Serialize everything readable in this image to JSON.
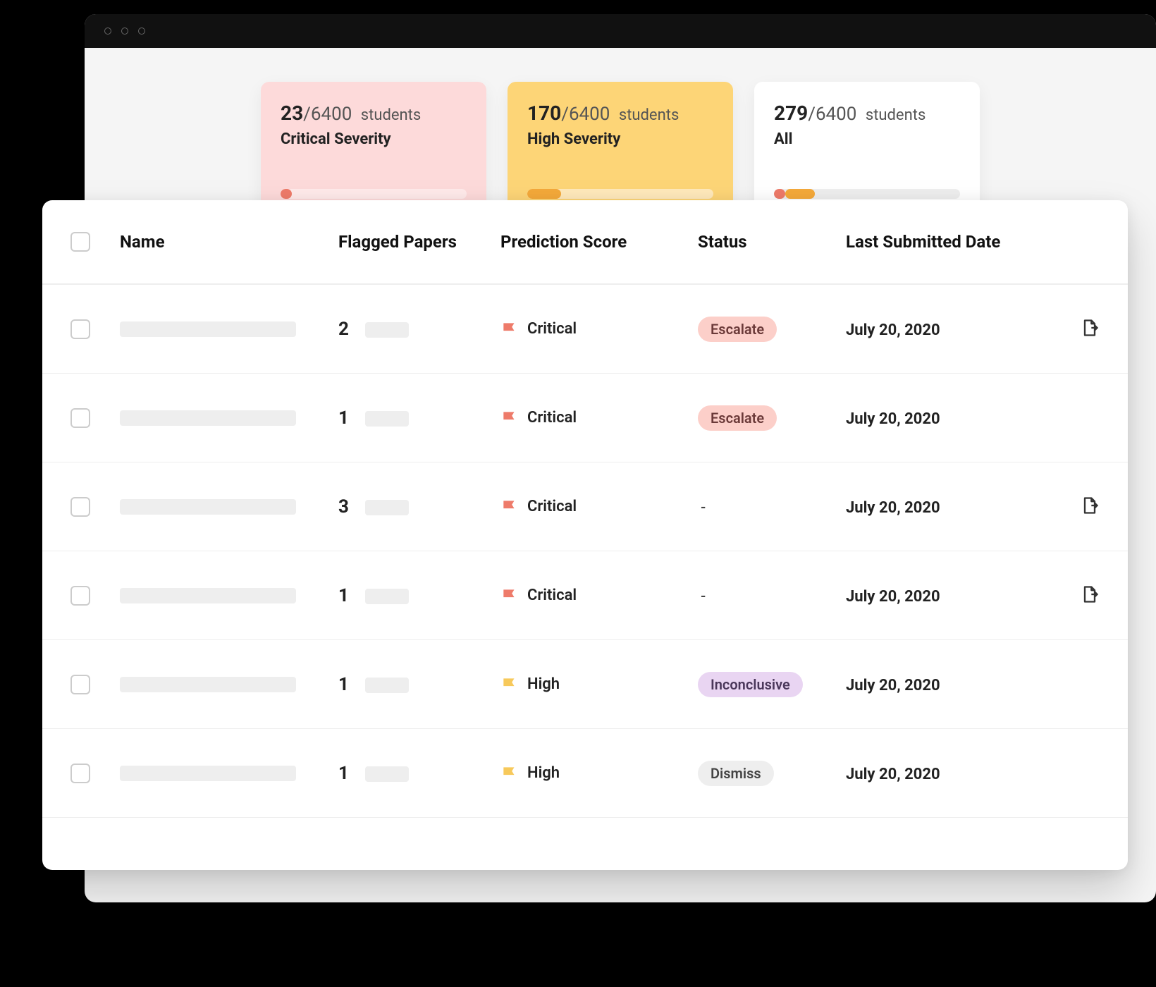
{
  "summary": {
    "cards": [
      {
        "count": "23",
        "total": "6400",
        "unit": "students",
        "label": "Critical Severity",
        "variant": "critical",
        "segments": [
          {
            "color": "#ee7b6a",
            "start": 0,
            "end": 6
          }
        ]
      },
      {
        "count": "170",
        "total": "6400",
        "unit": "students",
        "label": "High Severity",
        "variant": "high",
        "segments": [
          {
            "color": "#f4a93a",
            "start": 0,
            "end": 18
          }
        ]
      },
      {
        "count": "279",
        "total": "6400",
        "unit": "students",
        "label": "All",
        "variant": "all",
        "segments": [
          {
            "color": "#ee7b6a",
            "start": 0,
            "end": 6
          },
          {
            "color": "#f4a93a",
            "start": 6,
            "end": 22
          }
        ]
      }
    ]
  },
  "table": {
    "columns": {
      "name": "Name",
      "flagged": "Flagged Papers",
      "prediction": "Prediction Score",
      "status": "Status",
      "date": "Last Submitted Date"
    },
    "rows": [
      {
        "flagged": "2",
        "prediction": "Critical",
        "flagColor": "critical",
        "status": "Escalate",
        "statusClass": "escalate",
        "date": "July 20, 2020",
        "hasDoc": true
      },
      {
        "flagged": "1",
        "prediction": "Critical",
        "flagColor": "critical",
        "status": "Escalate",
        "statusClass": "escalate",
        "date": "July 20, 2020",
        "hasDoc": false
      },
      {
        "flagged": "3",
        "prediction": "Critical",
        "flagColor": "critical",
        "status": "-",
        "statusClass": "none",
        "date": "July 20, 2020",
        "hasDoc": true
      },
      {
        "flagged": "1",
        "prediction": "Critical",
        "flagColor": "critical",
        "status": "-",
        "statusClass": "none",
        "date": "July 20, 2020",
        "hasDoc": true
      },
      {
        "flagged": "1",
        "prediction": "High",
        "flagColor": "high",
        "status": "Inconclusive",
        "statusClass": "inconclusive",
        "date": "July 20, 2020",
        "hasDoc": false
      },
      {
        "flagged": "1",
        "prediction": "High",
        "flagColor": "high",
        "status": "Dismiss",
        "statusClass": "dismiss",
        "date": "July 20, 2020",
        "hasDoc": false
      }
    ]
  }
}
